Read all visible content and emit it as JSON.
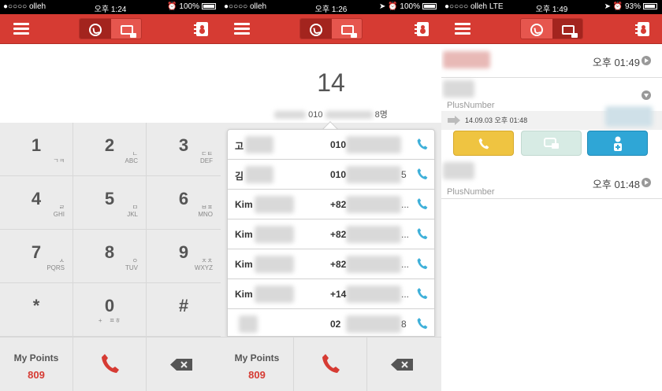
{
  "panels": [
    {
      "status": {
        "carrier": "●○○○○ olleh",
        "time": "오후 1:24",
        "battery": "100%"
      },
      "battery_level": 1.0
    },
    {
      "status": {
        "carrier": "●○○○○ olleh",
        "time": "오후 1:26",
        "battery": "100%"
      },
      "battery_level": 1.0
    },
    {
      "status": {
        "carrier": "●○○○○ olleh  LTE",
        "time": "오후 1:49",
        "battery": "93%"
      },
      "battery_level": 0.93
    }
  ],
  "colors": {
    "brand": "#d63b33",
    "call_green": "#efc441",
    "call_blue": "#2fa6d6"
  },
  "dialer": {
    "display_number": "",
    "keys": [
      {
        "digit": "1",
        "letters": "ㄱㅋ"
      },
      {
        "digit": "2",
        "letters": "ㄴ\nABC"
      },
      {
        "digit": "3",
        "letters": "ㄷㅌ\nDEF"
      },
      {
        "digit": "4",
        "letters": "ㄹ\nGHI"
      },
      {
        "digit": "5",
        "letters": "ㅁ\nJKL"
      },
      {
        "digit": "6",
        "letters": "ㅂㅍ\nMNO"
      },
      {
        "digit": "7",
        "letters": "ㅅ\nPQRS"
      },
      {
        "digit": "8",
        "letters": "ㅇ\nTUV"
      },
      {
        "digit": "9",
        "letters": "ㅈㅊ\nWXYZ"
      },
      {
        "digit": "*",
        "letters": ""
      },
      {
        "digit": "0",
        "letters": "+    ㅍㅎ"
      },
      {
        "digit": "#",
        "letters": ""
      }
    ],
    "points_label": "My Points",
    "points_value": "809"
  },
  "search": {
    "display_number": "14",
    "match_prefix": "010",
    "match_suffix": "8명",
    "results": [
      {
        "name": "고",
        "number": "010",
        "tail": ""
      },
      {
        "name": "김",
        "number": "010",
        "tail": "5"
      },
      {
        "name": "Kim",
        "number": "+82",
        "tail": "..."
      },
      {
        "name": "Kim",
        "number": "+82",
        "tail": "..."
      },
      {
        "name": "Kim",
        "number": "+82",
        "tail": "..."
      },
      {
        "name": "Kim",
        "number": "+14",
        "tail": "..."
      },
      {
        "name": "",
        "number": "02",
        "tail": "8"
      }
    ],
    "points_label": "My Points",
    "points_value": "809"
  },
  "log": {
    "entry1_time": "오후 01:49",
    "entry2_name": "PlusNumber",
    "detail": "14.09.03 오후 01:48",
    "entry3_time": "오후 01:48",
    "entry3_name": "PlusNumber"
  }
}
